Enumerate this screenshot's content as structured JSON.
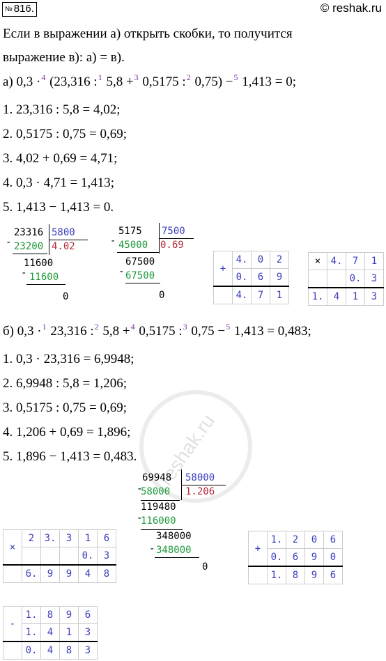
{
  "header": {
    "number_prefix": "№",
    "number": "816.",
    "site": "© reshak.ru"
  },
  "intro": {
    "line1": "Если в выражении а) открыть скобки, то получится",
    "line2": "выражение в):   а) = в)."
  },
  "part_a": {
    "label": "а)",
    "expr": [
      "0,3 ·",
      "4",
      "(23,316 :",
      "1",
      "5,8 +",
      "3",
      "0,5175 :",
      "2",
      "0,75)  −",
      "5",
      "1,413 = 0;"
    ],
    "steps": [
      "1.  23,316 : 5,8 = 4,02;",
      "2.  0,5175 : 0,75 = 0,69;",
      "3.  4,02 + 0,69 = 4,71;",
      "4.  0,3 · 4,71 = 1,413;",
      "5.  1,413 − 1,413 = 0."
    ],
    "div1": {
      "dividend": "23316",
      "divisor": "5800",
      "sub1": "23200",
      "quotient": "4.02",
      "rem1": "11600",
      "sub2": "11600",
      "rem2": "0"
    },
    "div2": {
      "dividend": "5175",
      "divisor": "7500",
      "sub1": "45000",
      "quotient": "0.69",
      "rem1": "67500",
      "sub2": "67500",
      "rem2": "0"
    },
    "add": {
      "op": "+",
      "rows": [
        [
          "4.",
          "0",
          "2"
        ],
        [
          "0.",
          "6",
          "9"
        ],
        [
          "4.",
          "7",
          "1"
        ]
      ]
    },
    "mul": {
      "op": "×",
      "rows": [
        [
          "4.",
          "7",
          "1"
        ],
        [
          "",
          "0.",
          "3"
        ],
        [
          "1.",
          "4",
          "1",
          "3"
        ]
      ]
    }
  },
  "part_b": {
    "label": "б)",
    "expr": [
      "0,3 ·",
      "1",
      "23,316 :",
      "2",
      "5,8 +",
      "4",
      "0,5175 :",
      "3",
      "0,75 −",
      "5",
      "1,413 = 0,483;"
    ],
    "steps": [
      "1.  0,3 · 23,316 = 6,9948;",
      "2.  6,9948 : 5,8 = 1,206;",
      "3.  0,5175 : 0,75 = 0,69;",
      "4.  1,206 + 0,69 = 1,896;",
      "5.  1,896 − 1,413 = 0,483."
    ],
    "div": {
      "dividend": "69948",
      "divisor": "58000",
      "sub1": "58000",
      "quotient": "1.206",
      "rem1": "119480",
      "sub2": "116000",
      "rem2": "348000",
      "sub3": "348000",
      "rem3": "0"
    },
    "mul": {
      "op": "×",
      "rows": [
        [
          "2",
          "3.",
          "3",
          "1",
          "6"
        ],
        [
          "",
          "",
          "",
          "0.",
          "3"
        ],
        [
          "6.",
          "9",
          "9",
          "4",
          "8"
        ]
      ]
    },
    "add": {
      "op": "+",
      "rows": [
        [
          "1.",
          "2",
          "0",
          "6"
        ],
        [
          "0.",
          "6",
          "9",
          "0"
        ],
        [
          "1.",
          "8",
          "9",
          "6"
        ]
      ]
    },
    "sub": {
      "op": "-",
      "rows": [
        [
          "1.",
          "8",
          "9",
          "6"
        ],
        [
          "1.",
          "4",
          "1",
          "3"
        ],
        [
          "0.",
          "4",
          "8",
          "3"
        ]
      ]
    }
  },
  "watermark": "reshak.ru"
}
